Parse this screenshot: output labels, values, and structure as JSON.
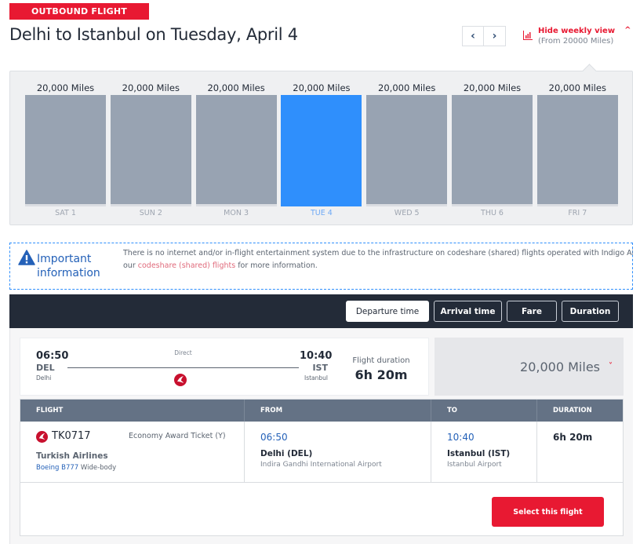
{
  "header": {
    "badge": "OUTBOUND FLIGHT",
    "title": "Delhi to Istanbul on Tuesday, April 4",
    "prev_icon": "chevron-left-icon",
    "next_icon": "chevron-right-icon",
    "weekly_toggle": {
      "title": "Hide weekly view",
      "subtitle": "(From 20000 Miles)",
      "icon": "bar-chart-icon",
      "caret": "chevron-up-icon"
    }
  },
  "colors": {
    "brand_red": "#e81932",
    "selected_blue": "#2f8ffc",
    "bar_gray": "#98a3b2",
    "dark_bar": "#232b38",
    "link_blue": "#2461b8"
  },
  "weekly": {
    "selected_index": 3,
    "days": [
      {
        "label": "SAT 1",
        "price": "20,000 Miles",
        "value": 20000
      },
      {
        "label": "SUN 2",
        "price": "20,000 Miles",
        "value": 20000
      },
      {
        "label": "MON 3",
        "price": "20,000 Miles",
        "value": 20000
      },
      {
        "label": "TUE 4",
        "price": "20,000 Miles",
        "value": 20000
      },
      {
        "label": "WED 5",
        "price": "20,000 Miles",
        "value": 20000
      },
      {
        "label": "THU 6",
        "price": "20,000 Miles",
        "value": 20000
      },
      {
        "label": "FRI 7",
        "price": "20,000 Miles",
        "value": 20000
      }
    ]
  },
  "info": {
    "icon": "warning-icon",
    "title_line1": "Important",
    "title_line2": "information",
    "text_line1": "There is no internet and/or in-flight entertainment system due to the infrastructure on codeshare (shared) flights operated with Indigo Airlines. Please see",
    "text_prefix": "our ",
    "link": "codeshare (shared) flights",
    "text_suffix": " for more information."
  },
  "sort": {
    "buttons": [
      {
        "label": "Departure time",
        "active": true
      },
      {
        "label": "Arrival time",
        "active": false
      },
      {
        "label": "Fare",
        "active": false
      },
      {
        "label": "Duration",
        "active": false
      }
    ]
  },
  "flight": {
    "summary": {
      "dep_time": "06:50",
      "dep_code": "DEL",
      "dep_city": "Delhi",
      "stops": "Direct",
      "arr_time": "10:40",
      "arr_code": "IST",
      "arr_city": "Istanbul",
      "duration_label": "Flight duration",
      "duration": "6h 20m",
      "fare": "20,000 Miles",
      "fare_caret": "chevron-down-icon"
    },
    "table": {
      "headers": [
        "FLIGHT",
        "FROM",
        "TO",
        "DURATION"
      ],
      "flight_number": "TK0717",
      "cabin": "Economy Award Ticket (Y)",
      "airline": "Turkish Airlines",
      "aircraft_link": "Boeing B777",
      "aircraft_type": " Wide-body",
      "from_time": "06:50",
      "from_city": "Delhi (DEL)",
      "from_airport": "Indira Gandhi International Airport",
      "to_time": "10:40",
      "to_city": "Istanbul (IST)",
      "to_airport": "Istanbul Airport",
      "duration": "6h 20m"
    },
    "select_label": "Select this flight"
  }
}
